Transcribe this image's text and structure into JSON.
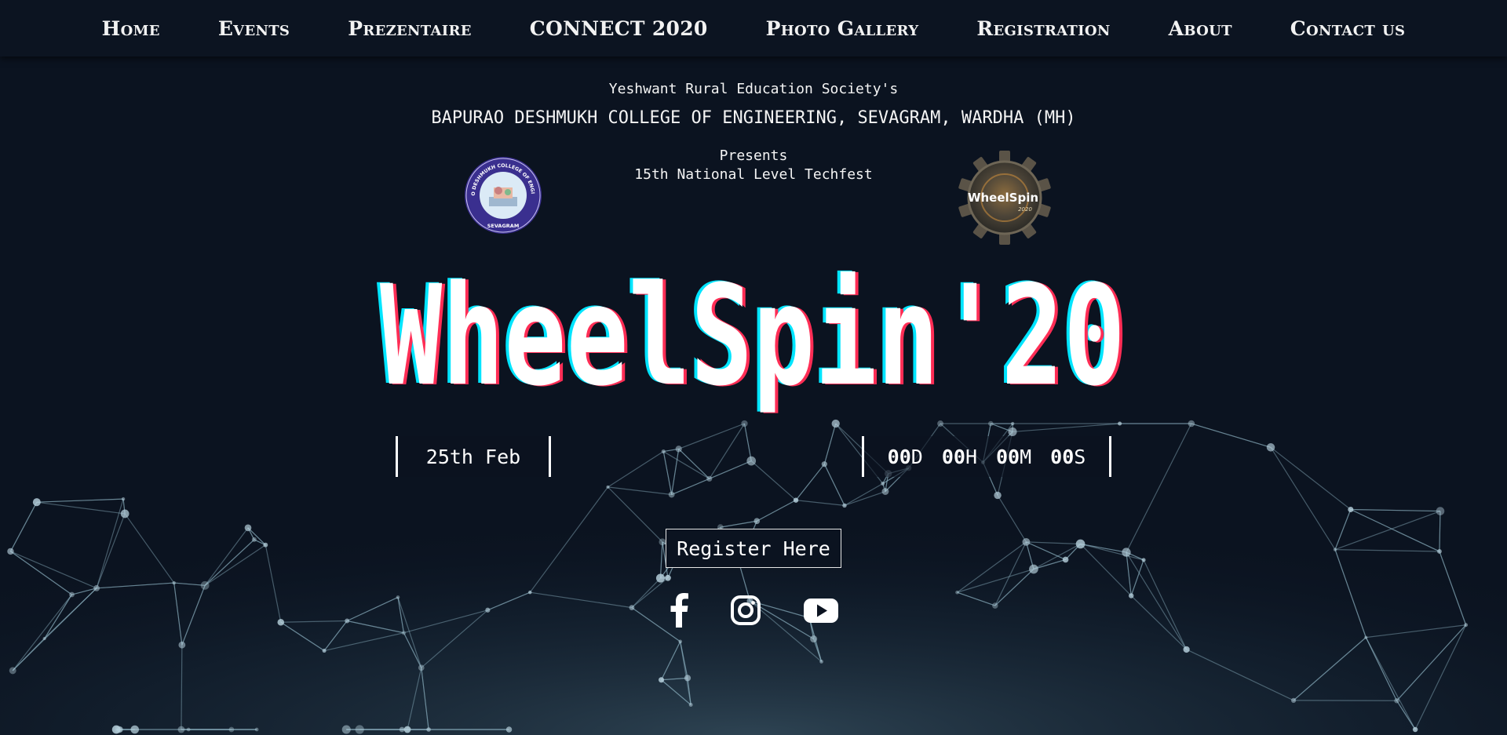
{
  "nav": {
    "items": [
      "Home",
      "Events",
      "Prezentaire",
      "CONNECT 2020",
      "Photo Gallery",
      "Registration",
      "About",
      "Contact us"
    ]
  },
  "header": {
    "society": "Yeshwant Rural Education Society's",
    "college": "BAPURAO DESHMUKH COLLEGE OF ENGINEERING, SEVAGRAM, WARDHA (MH)",
    "presents": "Presents",
    "techfest": "15th National Level Techfest"
  },
  "logos": {
    "left": {
      "text": "BAPURAO DESHMUKH COLLEGE OF ENGINEERING",
      "place": "SEVAGRAM"
    },
    "right": {
      "text": "WheelSpin",
      "year": "2020"
    }
  },
  "hero": {
    "title": "WheelSpin'20"
  },
  "event": {
    "date": "25th Feb"
  },
  "countdown": {
    "days": "00",
    "days_unit": "D",
    "hours": "00",
    "hours_unit": "H",
    "minutes": "00",
    "minutes_unit": "M",
    "seconds": "00",
    "seconds_unit": "S"
  },
  "cta": {
    "register_label": "Register Here"
  },
  "social": {
    "icons": [
      "facebook-icon",
      "instagram-icon",
      "youtube-icon"
    ]
  },
  "colors": {
    "background": "#0b1320",
    "network": "#8fb3c4",
    "glitch_cyan": "#00e5ff",
    "glitch_red": "#ff2d55"
  }
}
